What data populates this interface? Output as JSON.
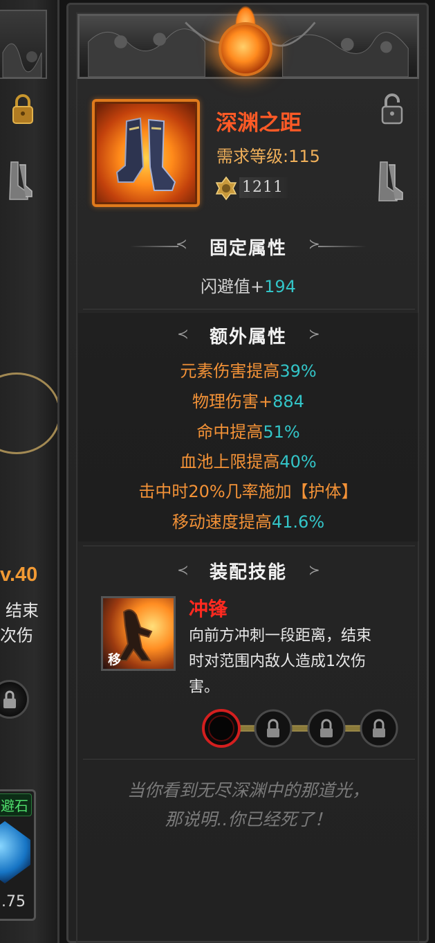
{
  "left_panel": {
    "level_text": "v.40",
    "desc_line1": "结束",
    "desc_line2": "次伤",
    "gem_tag": "避石",
    "gem_value": ".75"
  },
  "item": {
    "name": "深渊之距",
    "requirement": "需求等级:115",
    "power": "1211"
  },
  "fixed_attributes": {
    "title": "固定属性",
    "stats": [
      {
        "label": "闪避值+",
        "value": "194"
      }
    ]
  },
  "extra_attributes": {
    "title": "额外属性",
    "stats": [
      {
        "label": "元素伤害提高",
        "value": "39%"
      },
      {
        "label": "物理伤害+",
        "value": "884"
      },
      {
        "label": "命中提高",
        "value": "51%"
      },
      {
        "label": "血池上限提高",
        "value": "40%"
      },
      {
        "label": "击中时20%几率施加【护体】",
        "value": ""
      },
      {
        "label": "移动速度提高",
        "value": "41.6%"
      }
    ]
  },
  "equip_skill": {
    "title": "装配技能",
    "icon_badge": "移",
    "name": "冲锋",
    "desc_lines": [
      "向前方冲刺一段距离，结束",
      "时对范围内敌人造成1次伤",
      "害。"
    ]
  },
  "flavor": {
    "line1": "当你看到无尽深渊中的那道光，",
    "line2": "那说明..你已经死了！"
  },
  "colors": {
    "name": "#ff5a26",
    "requirement": "#f0b05a",
    "stat_label": "#f39237",
    "stat_value": "#33c5c8",
    "skill_name": "#ff2a20",
    "flavor": "#7a7a7a"
  },
  "icons": [
    "lock-icon",
    "boots-icon",
    "power-crest-icon",
    "unlock-icon",
    "skill-charge-icon",
    "gem-socket-icon",
    "locked-socket-icon"
  ]
}
